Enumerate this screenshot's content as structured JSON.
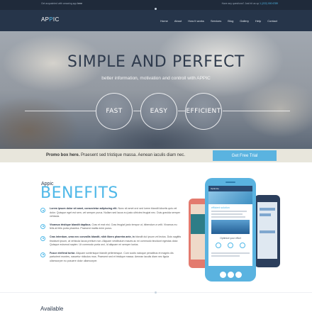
{
  "topbar": {
    "left_text": "Get acquainted with amazing app",
    "left_link": "here",
    "right_text": "Have any questions? Just hit us up",
    "right_phone": "1 (222) 000 6789"
  },
  "brand": {
    "logo_a": "AP",
    "logo_accent": "P",
    "logo_b": "IC",
    "accent_color": "#4fb8e8",
    "dark_color": "#26354a"
  },
  "nav": {
    "items": [
      "Home",
      "About",
      "How it works",
      "Services",
      "Blog",
      "Gallery",
      "Help",
      "Contact"
    ]
  },
  "hero": {
    "title": "SIMPLE AND PERFECT",
    "subtitle": "better information, motivation and controll with APPIC",
    "circles": [
      "FAST",
      "EASY",
      "EFFICIENT"
    ]
  },
  "promo": {
    "bold": "Promo box here.",
    "text": "Praesent sed tristique massa. Aenean iaculis diam nec.",
    "button": "Get Free Trial"
  },
  "benefits": {
    "small_title": "Appic",
    "title": "BENEFITS",
    "items": [
      {
        "bold": "Lorem ipsum dolor sit amet, consectetur adipiscing elit.",
        "text": "Nunc sit amet orci sed lorem blandit lobortis quis vel dolor. Quisque eget est sem, vel semper purus. Nullam sed lacus eu justo ultricies feugiat nec. Duis gravida semper vehicula."
      },
      {
        "bold": "Vivamus tristique blandit dapibus.",
        "text": "Cras et erat nisi. Cras feugiat justo tempor ut, bibendum a velit. Vivamus eu felis at felis porta pharetra. Praesent mattis enim purus."
      },
      {
        "bold": "Cras interdum, urna nec convallis blandit, nibh libero pharetra ante, in",
        "text": "blandit dui ipsum vel lectus. Duis sagittis tincidunt ipsum, at vehicula lacus pretium non. Aliquam vestibulum mauris ac mi commodo tincidunt egestas dolor. Quisque euismod sapien. Ut commodo porta orci, id aliquam mi semper luctus."
      },
      {
        "bold": "Fusce eleifend tortor.",
        "text": "Aliquam scelerisque blandit pellentesque. Cum sociis natoque penatibus et magnis dis parturient montes, nascetur ridiculus mus. Praesent sed et tristique massa. Aenean iaculis diam nec ligula ullamcorper eu posuere dolor ullamcorper."
      }
    ]
  },
  "phone": {
    "header": "Optimize",
    "heading": "efficient solution",
    "subheading": "Optimize your effort"
  },
  "available": {
    "title": "Available"
  }
}
